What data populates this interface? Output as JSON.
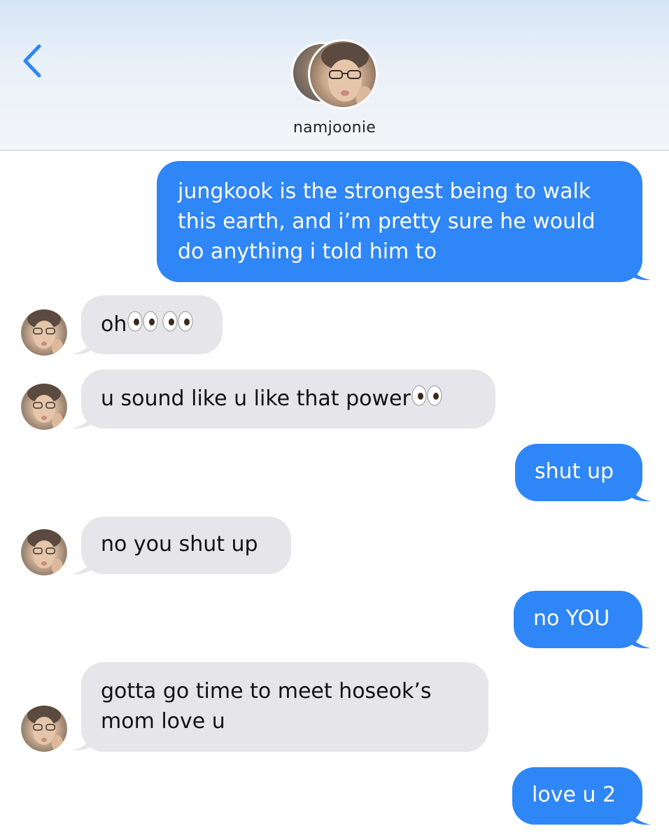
{
  "header": {
    "contact_name": "namjoonie"
  },
  "messages": [
    {
      "direction": "sent",
      "text": "jungkook is the strongest being to walk this earth, and i’m pretty sure he would do anything i told him to"
    },
    {
      "direction": "received",
      "text": "oh",
      "emoji": "👀👀"
    },
    {
      "direction": "received",
      "text": "u sound like u like that power",
      "emoji": "👀"
    },
    {
      "direction": "sent",
      "text": "shut up"
    },
    {
      "direction": "received",
      "text": "no you shut up"
    },
    {
      "direction": "sent",
      "text": "no YOU"
    },
    {
      "direction": "received",
      "text": "gotta go time to meet hoseok’s mom love u"
    },
    {
      "direction": "sent",
      "text": "love u 2"
    }
  ],
  "colors": {
    "sent_bubble": "#2f86f6",
    "received_bubble": "#e5e5ea",
    "accent": "#2f86f6"
  },
  "icons": {
    "back": "chevron-left-icon",
    "eyes": "eyes-emoji-icon"
  }
}
